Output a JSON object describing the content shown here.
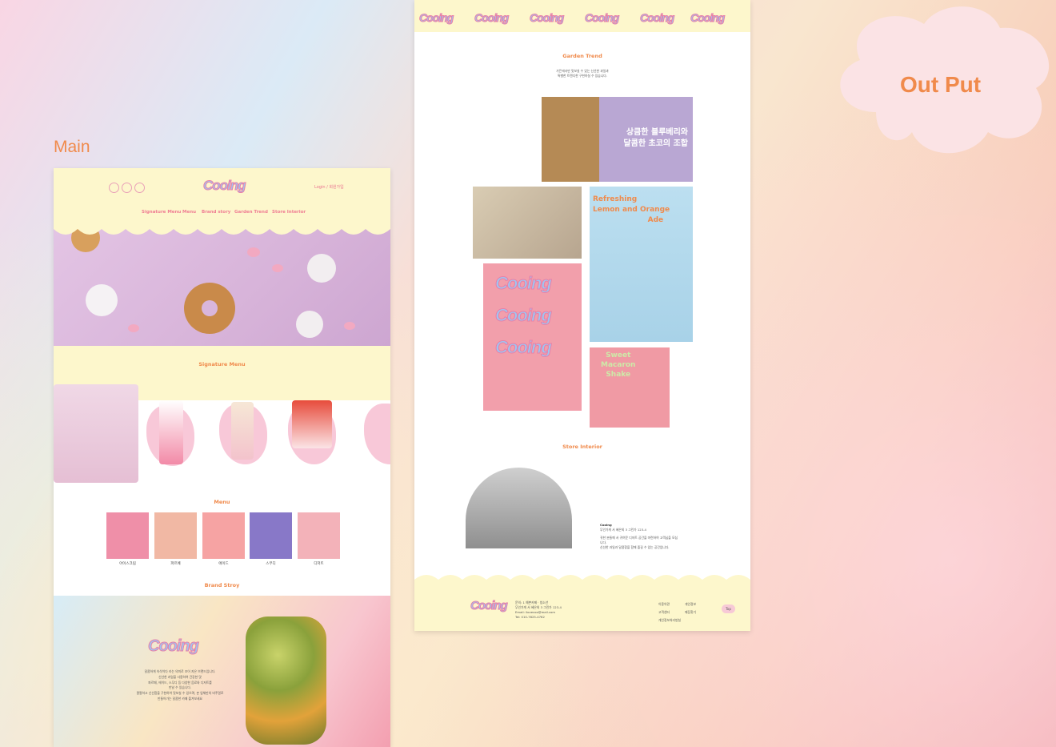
{
  "section_labels": {
    "main": "Main",
    "output": "Out Put"
  },
  "brand_logo": "Cooing",
  "header": {
    "login": "Login / 회원가입",
    "nav": [
      "Signature Menu",
      "Menu",
      "Brand story",
      "Garden Trend",
      "Store Interior"
    ]
  },
  "sections": {
    "signature": "Signature Menu",
    "menu": "Menu",
    "brand": "Brand Stroy",
    "garden": "Garden Trend",
    "interior": "Store Interior"
  },
  "menu_items": [
    "아이스크림",
    "파르페",
    "에이드",
    "스무디",
    "디저트"
  ],
  "brand_story": [
    "달콤하게 속삭이다 라는 의미로 조어 지은 브랜드입니다.",
    "신선한 과일을 사용하여 건강한 맛",
    "파르페, 에이드, 스무디 등 다양한 음료와 디저트를",
    "만날 수 있습니다.",
    "팔팔하고 신선함을 구현하여 맛보실 수 있으며, 본 업체만의 비주얼로",
    "만들어가는 달콤한 카페 즐겨보세요"
  ],
  "garden": {
    "desc": [
      "가든에서만 맛보실 수 있는 신선한 과일과",
      "특별한 트렌디한 구현하실 수 있습니다."
    ],
    "banner_text": [
      "상큼한 블루베리와",
      "달콤한 초코의 조합"
    ],
    "poster1": [
      "Refreshing",
      "Lemon and Orange",
      "Ade"
    ],
    "poster2": [
      "Sweet",
      "Macaron",
      "Shake"
    ],
    "poster3": [
      "Cooing",
      "Cooing",
      "Cooing"
    ]
  },
  "store": {
    "name": "Cooing",
    "addr": "무인가게 서 혜은외 3 그린가 123-4",
    "desc": [
      "귀한 분들께 서 귀여운 디저트 공간을 마련하여 고객님을 모십니다.",
      "신선한 과일과 달콤함을 함께 즐길 수 있는 공간입니다."
    ]
  },
  "footer": {
    "info": [
      "문의: 1 예쁜카페 · 청소년",
      "무인가게 서 혜은외 3 그린가 123-4",
      "Email: ilovecoo@mail.com",
      "Tel: 010-7825-4762"
    ],
    "links": [
      "이용약관",
      "개인정보",
      "고객센터",
      "매장찾기",
      "개인정보처리방침"
    ],
    "top": "Top"
  },
  "colors": {
    "orange": "#f08a4b",
    "pink": "#ef7d93",
    "cream": "#fdf7cc",
    "lavender": "#d7b3d9"
  }
}
